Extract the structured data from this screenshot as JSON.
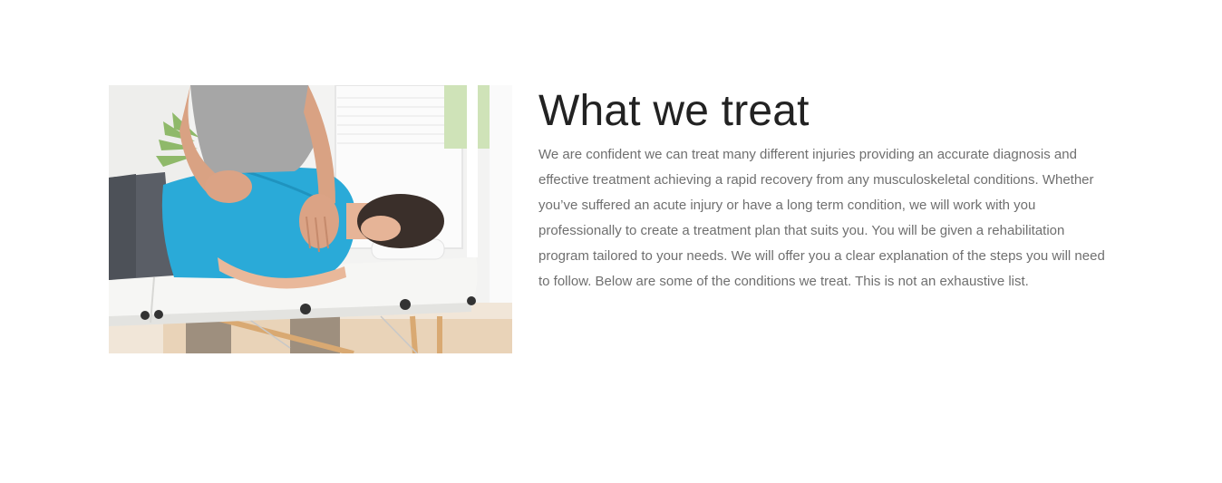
{
  "section": {
    "heading": "What we treat",
    "body": "We are confident we can treat many different injuries providing an accurate diagnosis and effective treatment achieving a rapid recovery from any musculoskeletal conditions. Whether you’ve suffered an acute injury or have a long term condition, we will work with you professionally to create a treatment plan that suits you. You will be given a rehabilitation program tailored to your needs. We will offer you a clear explanation of the steps you will need to follow. Below are some of the conditions we treat. This is not an exhaustive list."
  },
  "colors": {
    "heading": "#222222",
    "body_text": "#6f6f6f",
    "background": "#ffffff"
  }
}
